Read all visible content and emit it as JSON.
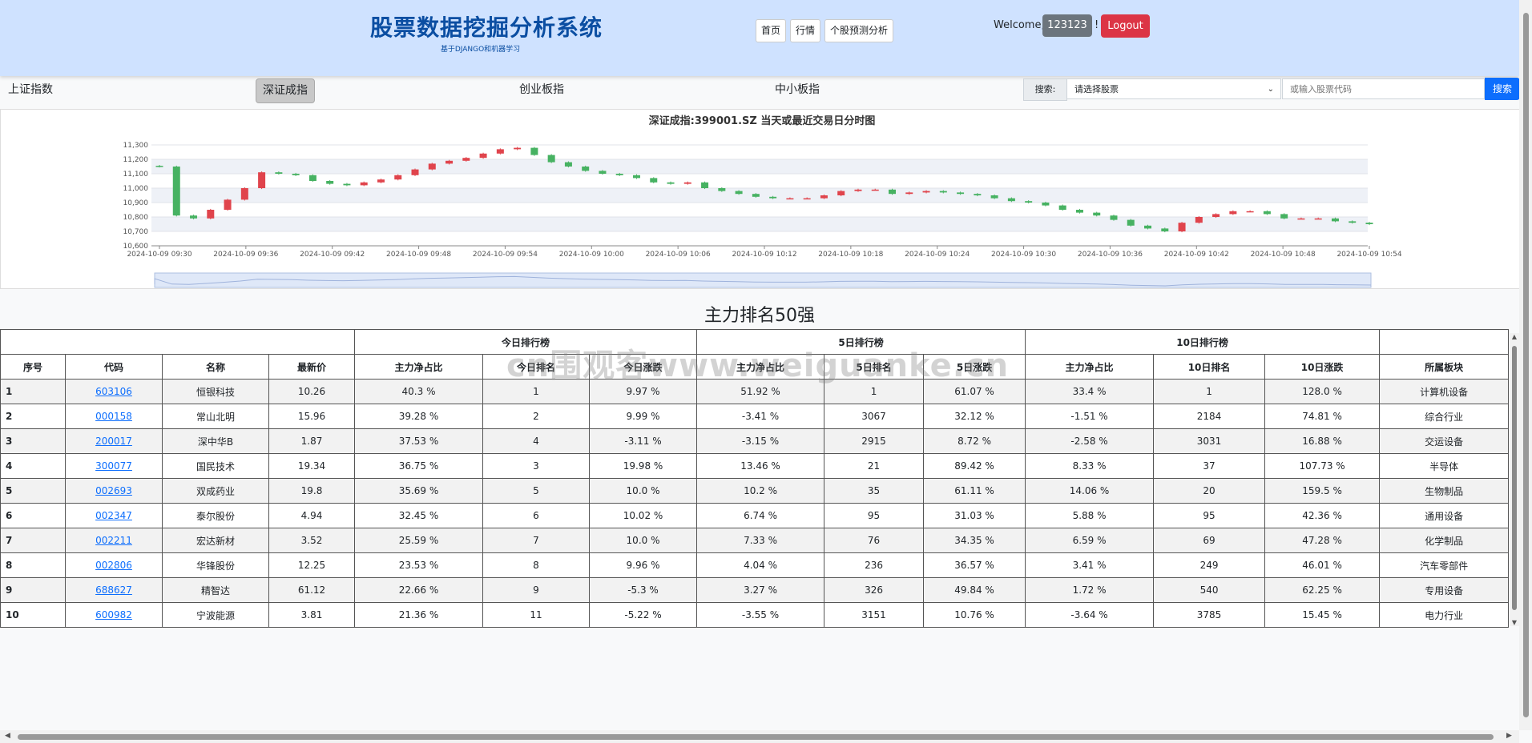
{
  "header": {
    "title": "股票数据挖掘分析系统",
    "subtitle": "基于DJANGO和机器学习",
    "nav": [
      "首页",
      "行情",
      "个股预测分析"
    ],
    "welcome": "Welcome,",
    "username": "123123",
    "bang": "!",
    "logout": "Logout"
  },
  "indices": [
    "上证指数",
    "深证成指",
    "创业板指",
    "中小板指"
  ],
  "search": {
    "label": "搜索:",
    "select_value": "请选择股票",
    "input_placeholder": "或输入股票代码",
    "button": "搜索"
  },
  "chart_data": {
    "type": "candlestick",
    "title": "深证成指:399001.SZ   当天或最近交易日分时图",
    "ylim": [
      10600,
      11300
    ],
    "yticks": [
      10600,
      10700,
      10800,
      10900,
      11000,
      11100,
      11200,
      11300
    ],
    "xticks": [
      "2024-10-09 09:30",
      "2024-10-09 09:36",
      "2024-10-09 09:42",
      "2024-10-09 09:48",
      "2024-10-09 09:54",
      "2024-10-09 10:00",
      "2024-10-09 10:06",
      "2024-10-09 10:12",
      "2024-10-09 10:18",
      "2024-10-09 10:24",
      "2024-10-09 10:30",
      "2024-10-09 10:36",
      "2024-10-09 10:42",
      "2024-10-09 10:48",
      "2024-10-09 10:54"
    ],
    "close": [
      11150,
      10810,
      10790,
      10850,
      10920,
      11000,
      11110,
      11100,
      11090,
      11050,
      11030,
      11020,
      11040,
      11060,
      11090,
      11130,
      11170,
      11190,
      11210,
      11240,
      11270,
      11280,
      11230,
      11180,
      11150,
      11120,
      11100,
      11090,
      11070,
      11040,
      11030,
      11040,
      11000,
      10980,
      10960,
      10940,
      10930,
      10930,
      10930,
      10950,
      10980,
      10990,
      10990,
      10960,
      10970,
      10980,
      10970,
      10960,
      10950,
      10930,
      10910,
      10900,
      10880,
      10850,
      10830,
      10810,
      10780,
      10740,
      10720,
      10700,
      10760,
      10800,
      10820,
      10840,
      10840,
      10820,
      10790,
      10790,
      10790,
      10770,
      10760,
      10750
    ]
  },
  "table": {
    "title": "主力排名50强",
    "group_headers": [
      "今日排行榜",
      "5日排行榜",
      "10日排行榜"
    ],
    "columns": [
      "序号",
      "代码",
      "名称",
      "最新价",
      "主力净占比",
      "今日排名",
      "今日涨跌",
      "主力净占比",
      "5日排名",
      "5日涨跌",
      "主力净占比",
      "10日排名",
      "10日涨跌",
      "所属板块"
    ],
    "rows": [
      [
        "1",
        "603106",
        "恒银科技",
        "10.26",
        "40.3 %",
        "1",
        "9.97 %",
        "51.92 %",
        "1",
        "61.07 %",
        "33.4 %",
        "1",
        "128.0 %",
        "计算机设备"
      ],
      [
        "2",
        "000158",
        "常山北明",
        "15.96",
        "39.28 %",
        "2",
        "9.99 %",
        "-3.41 %",
        "3067",
        "32.12 %",
        "-1.51 %",
        "2184",
        "74.81 %",
        "综合行业"
      ],
      [
        "3",
        "200017",
        "深中华B",
        "1.87",
        "37.53 %",
        "4",
        "-3.11 %",
        "-3.15 %",
        "2915",
        "8.72 %",
        "-2.58 %",
        "3031",
        "16.88 %",
        "交运设备"
      ],
      [
        "4",
        "300077",
        "国民技术",
        "19.34",
        "36.75 %",
        "3",
        "19.98 %",
        "13.46 %",
        "21",
        "89.42 %",
        "8.33 %",
        "37",
        "107.73 %",
        "半导体"
      ],
      [
        "5",
        "002693",
        "双成药业",
        "19.8",
        "35.69 %",
        "5",
        "10.0 %",
        "10.2 %",
        "35",
        "61.11 %",
        "14.06 %",
        "20",
        "159.5 %",
        "生物制品"
      ],
      [
        "6",
        "002347",
        "泰尔股份",
        "4.94",
        "32.45 %",
        "6",
        "10.02 %",
        "6.74 %",
        "95",
        "31.03 %",
        "5.88 %",
        "95",
        "42.36 %",
        "通用设备"
      ],
      [
        "7",
        "002211",
        "宏达新材",
        "3.52",
        "25.59 %",
        "7",
        "10.0 %",
        "7.33 %",
        "76",
        "34.35 %",
        "6.59 %",
        "69",
        "47.28 %",
        "化学制品"
      ],
      [
        "8",
        "002806",
        "华锋股份",
        "12.25",
        "23.53 %",
        "8",
        "9.96 %",
        "4.04 %",
        "236",
        "36.57 %",
        "3.41 %",
        "249",
        "46.01 %",
        "汽车零部件"
      ],
      [
        "9",
        "688627",
        "精智达",
        "61.12",
        "22.66 %",
        "9",
        "-5.3 %",
        "3.27 %",
        "326",
        "49.84 %",
        "1.72 %",
        "540",
        "62.25 %",
        "专用设备"
      ],
      [
        "10",
        "600982",
        "宁波能源",
        "3.81",
        "21.36 %",
        "11",
        "-5.22 %",
        "-3.55 %",
        "3151",
        "10.76 %",
        "-3.64 %",
        "3785",
        "15.45 %",
        "电力行业"
      ]
    ]
  },
  "watermark": "cn围观客www.weiguanke.cn",
  "colors": {
    "up": "#e0444c",
    "down": "#47b262",
    "header_bg": "#cfe2ff",
    "accent": "#0d6efd",
    "logout": "#dc3545"
  }
}
